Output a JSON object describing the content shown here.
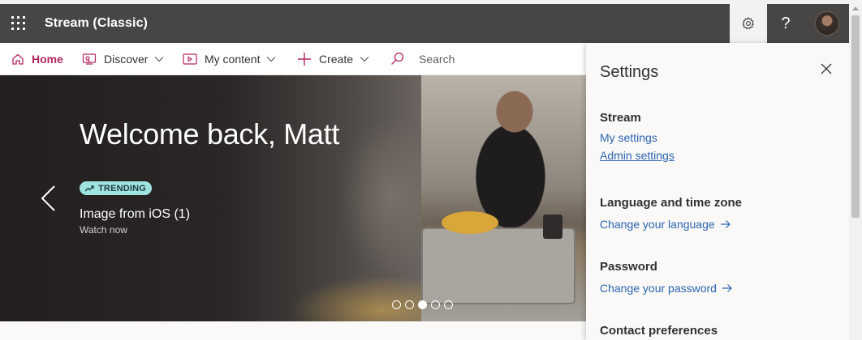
{
  "app": {
    "title": "Stream (Classic)"
  },
  "nav": {
    "home": "Home",
    "discover": "Discover",
    "my_content": "My content",
    "create": "Create",
    "search_placeholder": "Search"
  },
  "hero": {
    "welcome": "Welcome back, Matt",
    "badge": "TRENDING",
    "video_title": "Image from iOS (1)",
    "video_subtitle": "Watch now",
    "carousel_count": 5,
    "carousel_active_index": 2
  },
  "settings": {
    "title": "Settings",
    "sections": [
      {
        "heading": "Stream",
        "links": [
          "My settings",
          "Admin settings"
        ]
      },
      {
        "heading": "Language and time zone",
        "links": [
          "Change your language"
        ]
      },
      {
        "heading": "Password",
        "links": [
          "Change your password"
        ]
      },
      {
        "heading": "Contact preferences",
        "links": []
      }
    ]
  },
  "icons": {
    "waffle": "app-launcher-icon",
    "gear": "gear-icon",
    "help": "?",
    "close": "close-icon"
  },
  "colors": {
    "suite_bar": "#484644",
    "brand_accent": "#b4275c",
    "link": "#2b64b3",
    "trending_badge": "#a0e4e0"
  }
}
